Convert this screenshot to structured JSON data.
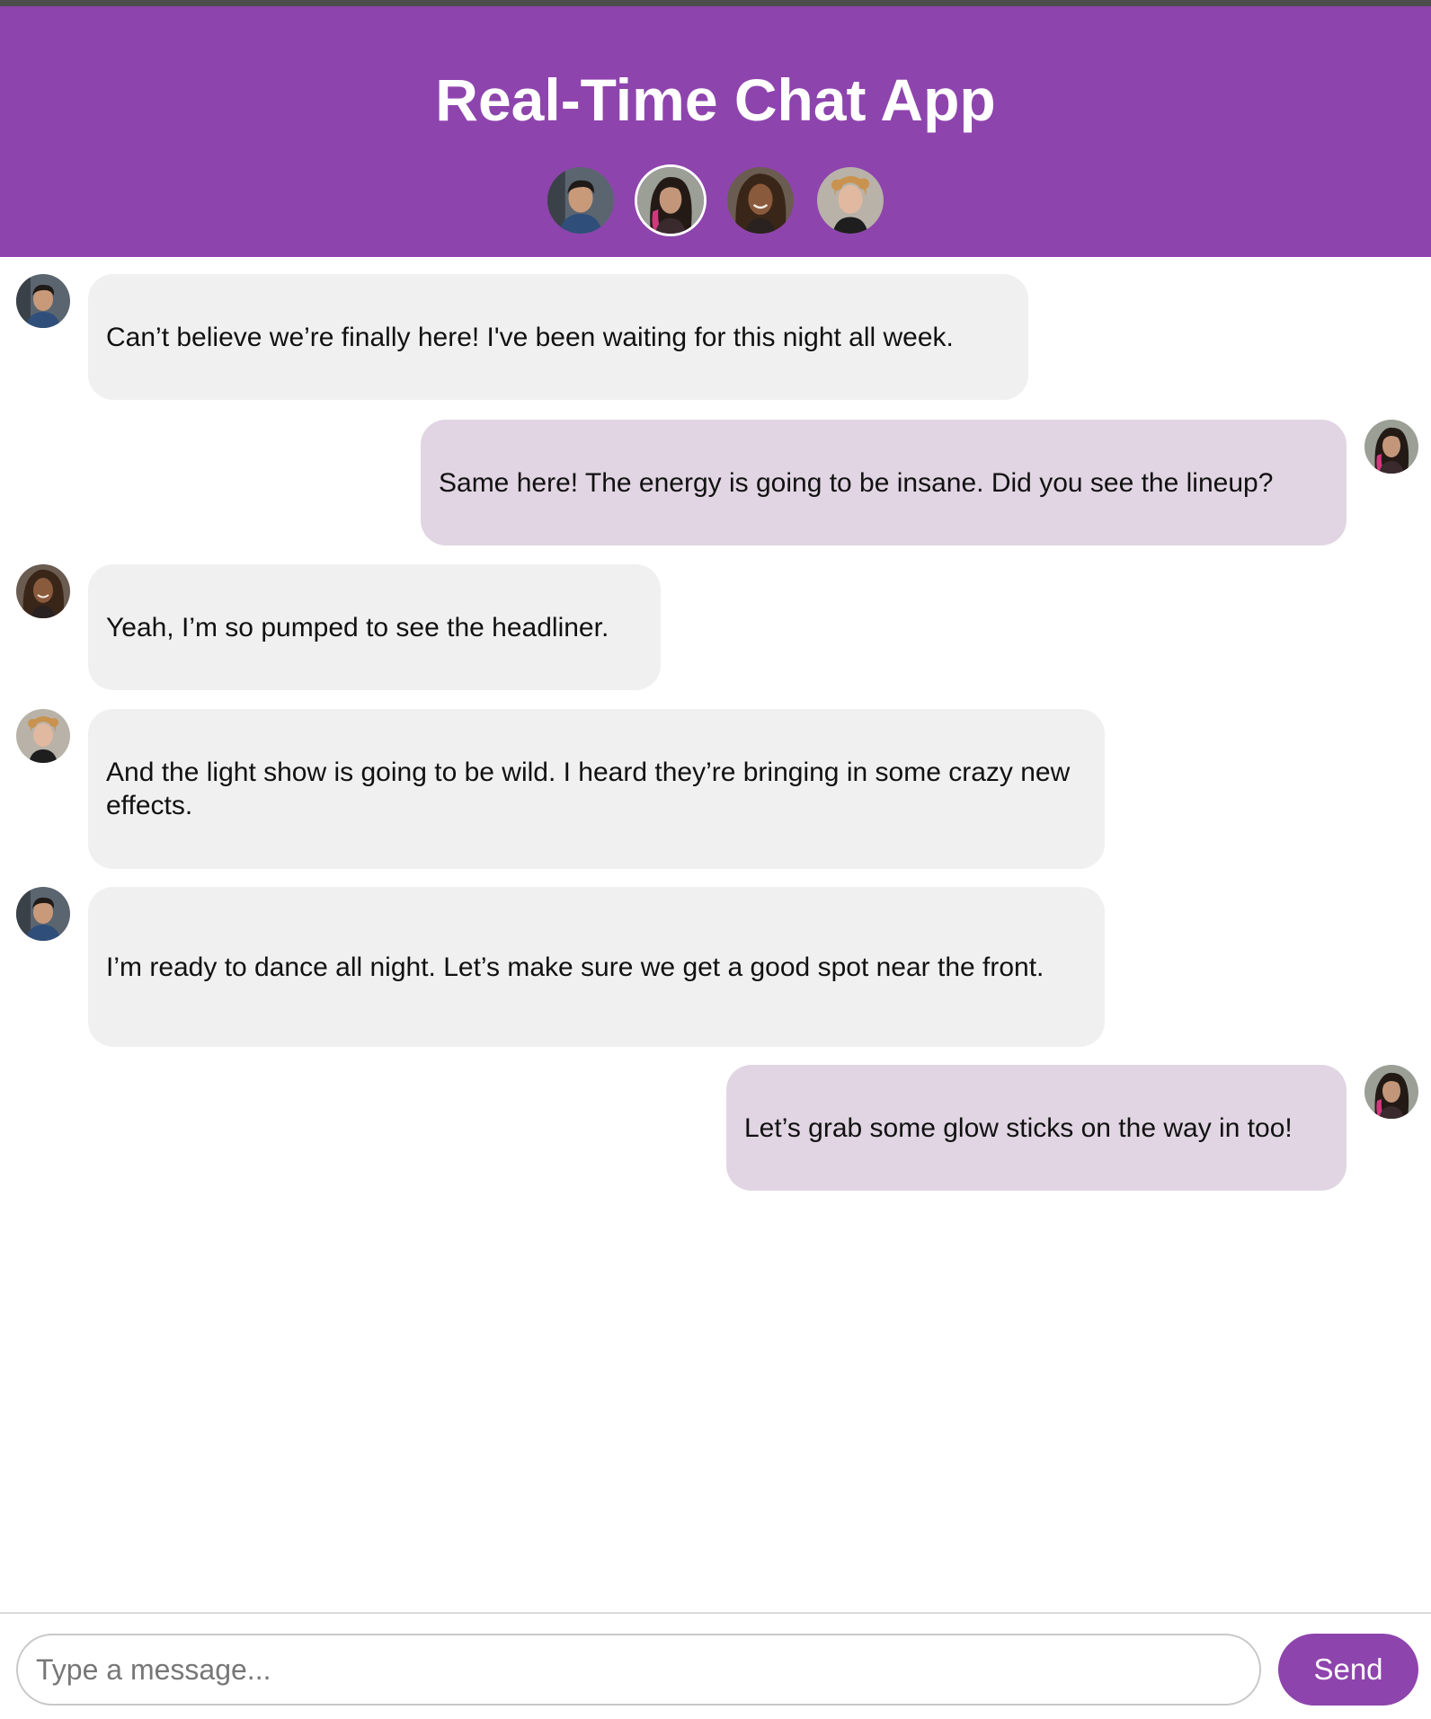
{
  "header": {
    "title": "Real-Time Chat App",
    "participants": [
      {
        "avatar": "avatar-man-dark-hair",
        "active": false
      },
      {
        "avatar": "avatar-woman-pink-streak",
        "active": true
      },
      {
        "avatar": "avatar-woman-curly-hair",
        "active": false
      },
      {
        "avatar": "avatar-man-blond-curly",
        "active": false
      }
    ]
  },
  "messages": [
    {
      "direction": "incoming",
      "avatar": "avatar-man-dark-hair",
      "text": "Can’t believe we’re finally here! I've been waiting for this night all week."
    },
    {
      "direction": "outgoing",
      "avatar": "avatar-woman-pink-streak",
      "text": "Same here! The energy is going to be insane. Did you see the lineup?"
    },
    {
      "direction": "incoming",
      "avatar": "avatar-woman-curly-hair",
      "text": "Yeah, I’m so pumped to see the headliner."
    },
    {
      "direction": "incoming",
      "avatar": "avatar-man-blond-curly",
      "text": "And the light show is going to be wild. I heard they’re bringing in some crazy new effects."
    },
    {
      "direction": "incoming",
      "avatar": "avatar-man-dark-hair",
      "text": "I’m ready to dance all night. Let’s make sure we get a good spot near the front."
    },
    {
      "direction": "outgoing",
      "avatar": "avatar-woman-pink-streak",
      "text": "Let’s grab some glow sticks on the way in too!"
    }
  ],
  "composer": {
    "placeholder": "Type a message...",
    "value": "",
    "send_label": "Send"
  },
  "colors": {
    "header_bg": "#8e44ad",
    "incoming_bubble": "#f0f0f0",
    "outgoing_bubble": "#e1d5e3",
    "send_button": "#8e44ad"
  }
}
